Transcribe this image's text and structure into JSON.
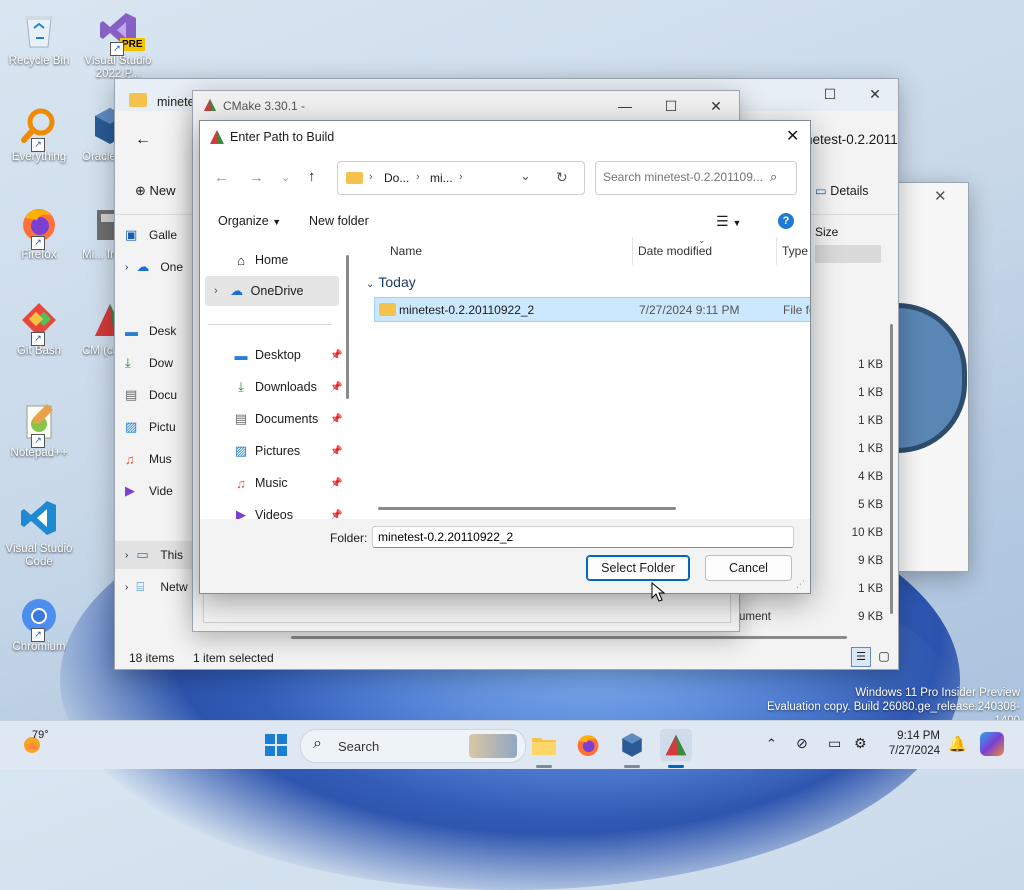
{
  "desktop": {
    "icons": [
      {
        "label": "Recycle Bin"
      },
      {
        "label": "Visual Studio 2022 P..."
      },
      {
        "label": "Everything"
      },
      {
        "label": "Oracle Virtu..."
      },
      {
        "label": "Firefox"
      },
      {
        "label": "Mi... Inst..."
      },
      {
        "label": "Git Bash"
      },
      {
        "label": "CM (cma..."
      },
      {
        "label": "Notepad++"
      },
      {
        "label": "Visual Studio Code"
      },
      {
        "label": "Chromium"
      }
    ],
    "vs_badge": "PRE",
    "watermark_line1": "Windows 11 Pro Insider Preview",
    "watermark_line2": "Evaluation copy. Build 26080.ge_release.240308-1400"
  },
  "explorer": {
    "tab_title": "minete",
    "title_right": "netest-0.2.2011",
    "new_label": "New",
    "details_label": "Details",
    "size_header": "Size",
    "nav": [
      "Galle",
      "One",
      "Desk",
      "Dow",
      "Docu",
      "Pictu",
      "Mus",
      "Vide",
      "This",
      "Netw"
    ],
    "sizes": [
      "1 KB",
      "1 KB",
      "1 KB",
      "1 KB",
      "4 KB",
      "5 KB",
      "10 KB",
      "9 KB",
      "1 KB",
      "9 KB"
    ],
    "ument_text": "ument",
    "status_items": "18 items",
    "status_selected": "1 item selected"
  },
  "cmake": {
    "title": "CMake 3.30.1 -"
  },
  "dialog": {
    "title": "Enter Path to Build",
    "breadcrumb": [
      "Do...",
      "mi..."
    ],
    "search_placeholder": "Search minetest-0.2.201109...",
    "organize_label": "Organize",
    "new_folder_label": "New folder",
    "sidebar": {
      "home": "Home",
      "onedrive": "OneDrive",
      "pinned": [
        "Desktop",
        "Downloads",
        "Documents",
        "Pictures",
        "Music",
        "Videos"
      ]
    },
    "columns": {
      "name": "Name",
      "date": "Date modified",
      "type": "Type"
    },
    "group_label": "Today",
    "rows": [
      {
        "name": "minetest-0.2.20110922_2",
        "date": "7/27/2024 9:11 PM",
        "type": "File fo"
      }
    ],
    "folder_label": "Folder:",
    "folder_value": "minetest-0.2.20110922_2",
    "select_button": "Select Folder",
    "cancel_button": "Cancel"
  },
  "taskbar": {
    "weather_temp": "79°",
    "search_label": "Search",
    "time": "9:14 PM",
    "date": "7/27/2024"
  },
  "colors": {
    "accent": "#0067c0",
    "selection": "#cce8ff",
    "taskbar": "#dfe8f2"
  }
}
